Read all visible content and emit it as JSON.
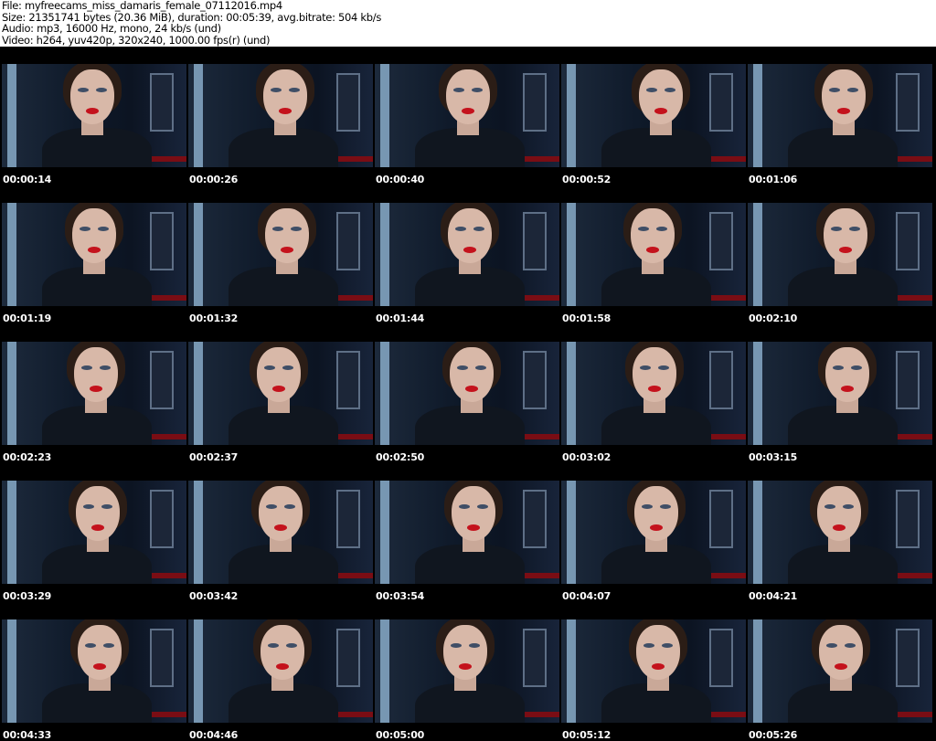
{
  "header": {
    "file": "File: myfreecams_miss_damaris_female_07112016.mp4",
    "size": "Size: 21351741 bytes (20.36 MiB), duration: 00:05:39, avg.bitrate: 504 kb/s",
    "audio": "Audio: mp3, 16000 Hz, mono, 24 kb/s (und)",
    "video": "Video: h264, yuv420p, 320x240, 1000.00 fps(r) (und)"
  },
  "thumbnails": [
    "00:00:14",
    "00:00:26",
    "00:00:40",
    "00:00:52",
    "00:01:06",
    "00:01:19",
    "00:01:32",
    "00:01:44",
    "00:01:58",
    "00:02:10",
    "00:02:23",
    "00:02:37",
    "00:02:50",
    "00:03:02",
    "00:03:15",
    "00:03:29",
    "00:03:42",
    "00:03:54",
    "00:04:07",
    "00:04:21",
    "00:04:33",
    "00:04:46",
    "00:05:00",
    "00:05:12",
    "00:05:26"
  ]
}
